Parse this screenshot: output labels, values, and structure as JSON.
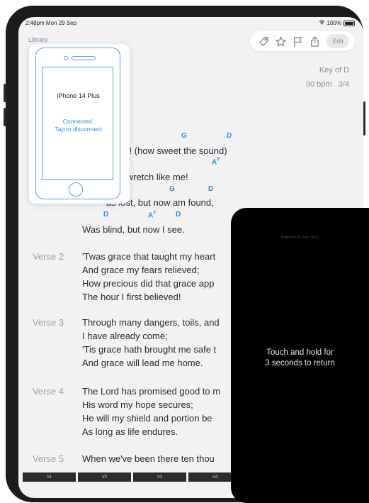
{
  "status_bar": {
    "time": "2:48pm  Mon 29 Sep",
    "battery": "100%"
  },
  "nav": {
    "back_label": "Library"
  },
  "toolbar": {
    "icons": [
      "tag-icon",
      "star-icon",
      "flag-icon",
      "share-icon"
    ],
    "edit_label": "Edit"
  },
  "song_meta": {
    "key": "Key of D",
    "tempo": "90 bpm",
    "time_signature": "3/4"
  },
  "verse1": {
    "chords_line1": [
      "G",
      "D"
    ],
    "line1": "grace! (how sweet the sound)",
    "chords_line2": [
      "A",
      "7"
    ],
    "line2": "ed a wretch like me!",
    "chords_line3": [
      "G",
      "D"
    ],
    "line3": "as lost, but now am found,",
    "chords_line4": [
      "D",
      "A",
      "7",
      "D"
    ],
    "line4": "Was blind, but now I see."
  },
  "verses": [
    {
      "label": "Verse 2",
      "lines": [
        "'Twas grace that taught my heart",
        "And grace my fears relieved;",
        "How precious did that grace app",
        "The hour I first believed!"
      ]
    },
    {
      "label": "Verse 3",
      "lines": [
        "Through many dangers, toils, and",
        "I have already come;",
        "'Tis grace hath brought me safe t",
        "And grace will lead me home."
      ]
    },
    {
      "label": "Verse 4",
      "lines": [
        "The Lord has promised good to m",
        "His word my hope secures;",
        "He will my shield and portion be",
        "As long as life endures."
      ]
    },
    {
      "label": "Verse 5",
      "lines": [
        "When we've been there ten thou"
      ]
    }
  ],
  "device_popover": {
    "device_name": "iPhone 14 Plus",
    "status_line1": "Connected.",
    "status_line2": "Tap to disconnect"
  },
  "overlay_panel": {
    "title": "iPad Pro 11-inch (M4)",
    "message_line1": "Touch and hold for",
    "message_line2": "3 seconds to return"
  },
  "bottom_tabs": [
    "V1",
    "V2",
    "V3",
    "V4"
  ],
  "colors": {
    "accent": "#2a8de0",
    "device_outline": "#5b9be6",
    "overlay": "#000000"
  }
}
